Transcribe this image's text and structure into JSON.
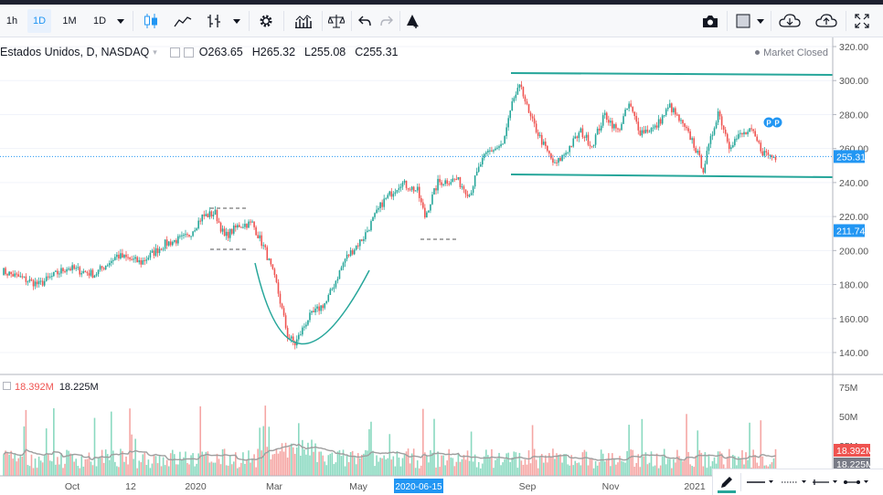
{
  "toolbar": {
    "intervals": [
      "1h",
      "1D",
      "1M",
      "1D"
    ],
    "active_interval": "1D"
  },
  "legend": {
    "symbol": "Estados Unidos, D, NASDAQ",
    "open_label": "O",
    "open": "263.65",
    "high_label": "H",
    "high": "265.32",
    "low_label": "L",
    "low": "255.08",
    "close_label": "C",
    "close": "255.31"
  },
  "market_status": "Market Closed",
  "volume": {
    "value": "18.392M",
    "ma": "18.225M"
  },
  "colors": {
    "up": "#26a69a",
    "down": "#ef5350",
    "channel": "#26a69a",
    "vol_up": "#8ad9c0",
    "vol_down": "#f5a6a4",
    "accent": "#2196f3"
  },
  "chart_data": {
    "type": "candlestick",
    "price_axis": {
      "ticks": [
        "320.00",
        "300.00",
        "280.00",
        "260.00",
        "240.00",
        "220.00",
        "200.00",
        "180.00",
        "160.00",
        "140.00"
      ],
      "ylim": [
        120,
        325
      ]
    },
    "volume_axis": {
      "ticks": [
        "75M",
        "50M",
        "25M"
      ]
    },
    "time_axis": {
      "ticks": [
        "Oct",
        "12",
        "2020",
        "Mar",
        "May",
        "Sep",
        "Nov",
        "2021"
      ],
      "highlight": "2020-06-15"
    },
    "last_price": "255.31",
    "marker_price": "211.74",
    "last_volume": "18.392M",
    "volume_ma": "18.225M",
    "labels": [
      "P",
      "P"
    ],
    "anchors": [
      {
        "i": 0,
        "p": 188
      },
      {
        "i": 20,
        "p": 180
      },
      {
        "i": 35,
        "p": 190
      },
      {
        "i": 50,
        "p": 186
      },
      {
        "i": 62,
        "p": 197
      },
      {
        "i": 75,
        "p": 193
      },
      {
        "i": 88,
        "p": 204
      },
      {
        "i": 100,
        "p": 208
      },
      {
        "i": 108,
        "p": 220
      },
      {
        "i": 115,
        "p": 222
      },
      {
        "i": 120,
        "p": 208
      },
      {
        "i": 128,
        "p": 215
      },
      {
        "i": 135,
        "p": 216
      },
      {
        "i": 142,
        "p": 200
      },
      {
        "i": 148,
        "p": 180
      },
      {
        "i": 154,
        "p": 150
      },
      {
        "i": 158,
        "p": 145
      },
      {
        "i": 165,
        "p": 160
      },
      {
        "i": 175,
        "p": 170
      },
      {
        "i": 185,
        "p": 195
      },
      {
        "i": 195,
        "p": 208
      },
      {
        "i": 205,
        "p": 228
      },
      {
        "i": 215,
        "p": 240
      },
      {
        "i": 224,
        "p": 235
      },
      {
        "i": 228,
        "p": 220
      },
      {
        "i": 235,
        "p": 240
      },
      {
        "i": 245,
        "p": 242
      },
      {
        "i": 252,
        "p": 233
      },
      {
        "i": 258,
        "p": 251
      },
      {
        "i": 262,
        "p": 258
      },
      {
        "i": 270,
        "p": 262
      },
      {
        "i": 276,
        "p": 290
      },
      {
        "i": 280,
        "p": 297
      },
      {
        "i": 284,
        "p": 280
      },
      {
        "i": 292,
        "p": 262
      },
      {
        "i": 298,
        "p": 250
      },
      {
        "i": 304,
        "p": 258
      },
      {
        "i": 312,
        "p": 270
      },
      {
        "i": 318,
        "p": 262
      },
      {
        "i": 325,
        "p": 280
      },
      {
        "i": 332,
        "p": 270
      },
      {
        "i": 338,
        "p": 286
      },
      {
        "i": 344,
        "p": 270
      },
      {
        "i": 352,
        "p": 272
      },
      {
        "i": 360,
        "p": 285
      },
      {
        "i": 366,
        "p": 275
      },
      {
        "i": 372,
        "p": 265
      },
      {
        "i": 378,
        "p": 248
      },
      {
        "i": 386,
        "p": 282
      },
      {
        "i": 392,
        "p": 262
      },
      {
        "i": 398,
        "p": 268
      },
      {
        "i": 404,
        "p": 270
      },
      {
        "i": 410,
        "p": 258
      },
      {
        "i": 416,
        "p": 255
      }
    ]
  }
}
